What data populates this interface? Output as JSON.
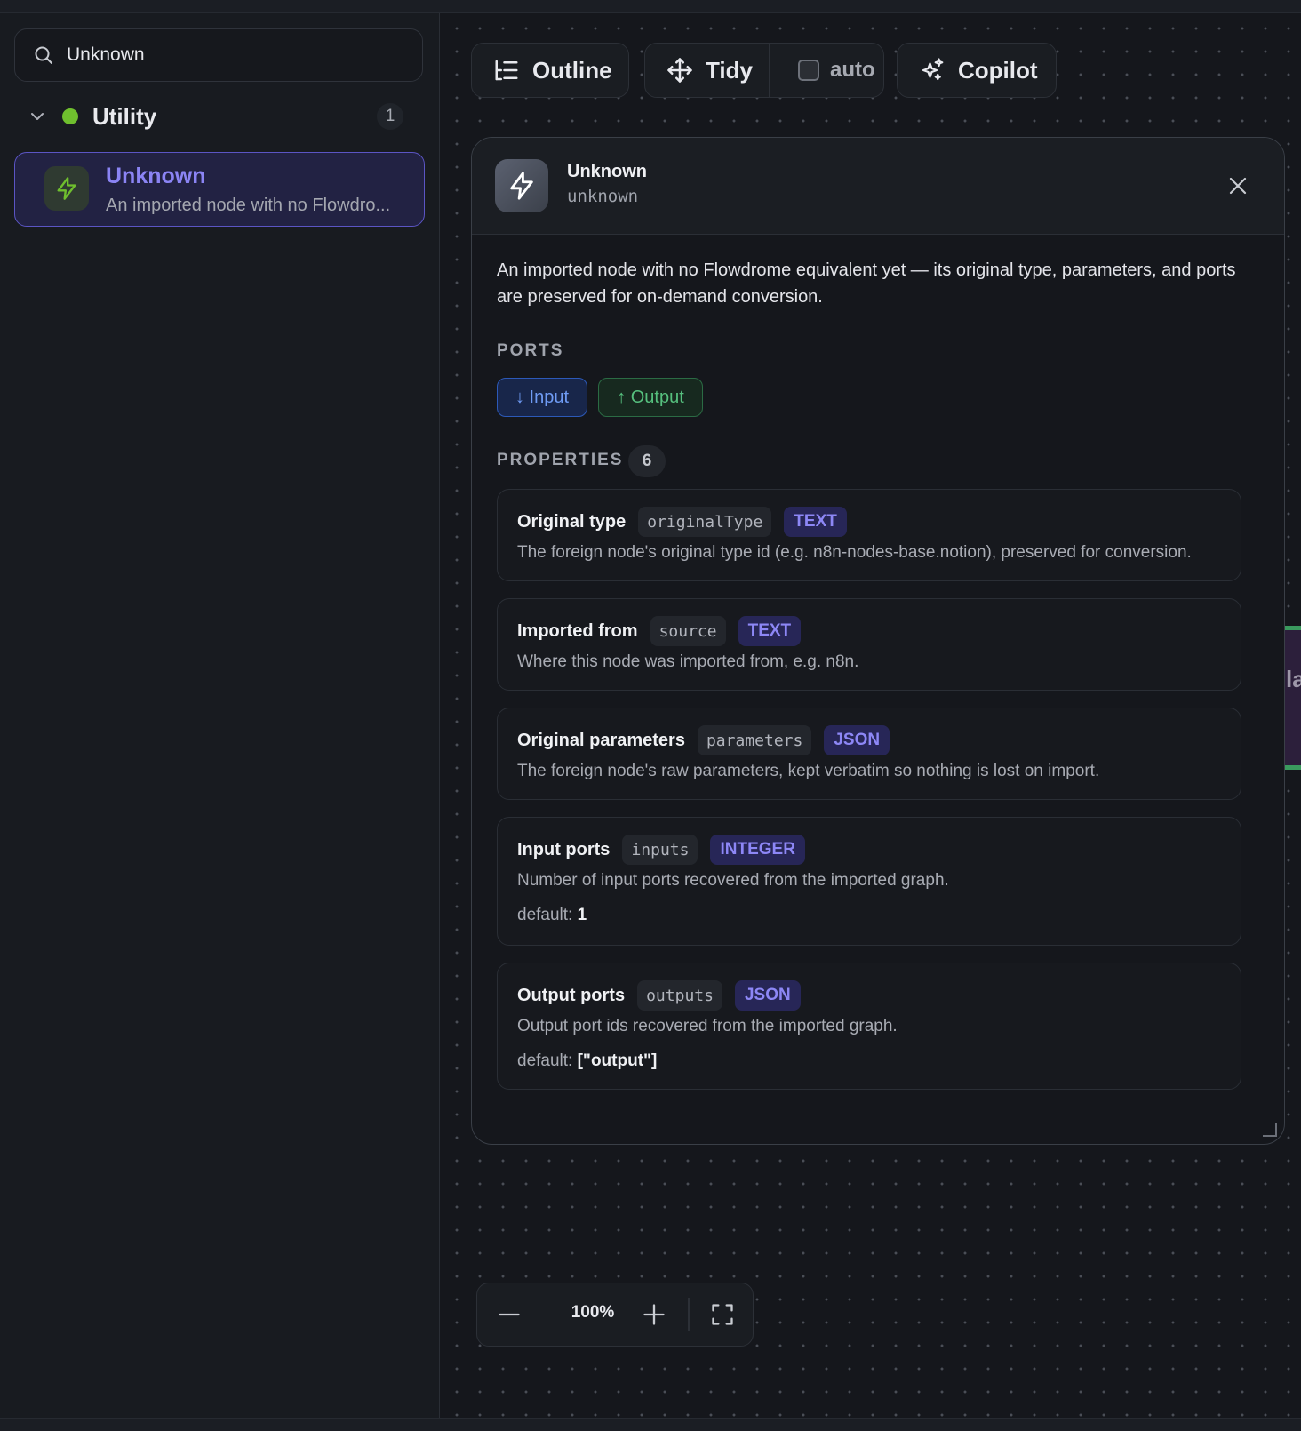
{
  "sidebar": {
    "search": {
      "value": "Unknown"
    },
    "group": {
      "label": "Utility",
      "count": "1",
      "dot_color": "#6fbf2e"
    },
    "node": {
      "title": "Unknown",
      "description": "An imported node with no Flowdro..."
    }
  },
  "toolbar": {
    "outline_label": "Outline",
    "tidy_label": "Tidy",
    "auto_label": "auto",
    "auto_checked": false,
    "copilot_label": "Copilot"
  },
  "panel": {
    "title": "Unknown",
    "subtitle": "unknown",
    "description": "An imported node with no Flowdrome equivalent yet — its original type, parameters, and ports are preserved for on-demand conversion.",
    "ports_label": "PORTS",
    "ports": {
      "input": "↓ Input",
      "output": "↑ Output"
    },
    "properties_label": "PROPERTIES",
    "properties_count": "6",
    "properties": [
      {
        "name": "Original type",
        "key": "originalType",
        "type": "TEXT",
        "description": "The foreign node's original type id (e.g. n8n-nodes-base.notion), preserved for conversion."
      },
      {
        "name": "Imported from",
        "key": "source",
        "type": "TEXT",
        "description": "Where this node was imported from, e.g. n8n."
      },
      {
        "name": "Original parameters",
        "key": "parameters",
        "type": "JSON",
        "description": "The foreign node's raw parameters, kept verbatim so nothing is lost on import."
      },
      {
        "name": "Input ports",
        "key": "inputs",
        "type": "INTEGER",
        "description": "Number of input ports recovered from the imported graph.",
        "default_label": "default:",
        "default_value": "1"
      },
      {
        "name": "Output ports",
        "key": "outputs",
        "type": "JSON",
        "description": "Output port ids recovered from the imported graph.",
        "default_label": "default:",
        "default_value": "[\"output\"]"
      }
    ]
  },
  "canvas": {
    "partial_node_text": "la"
  },
  "zoom": {
    "level": "100%"
  },
  "colors": {
    "accent": "#8b84f4",
    "input_port": "#6f9bf4",
    "output_port": "#56c07e",
    "node_icon": "#6fbf2e"
  },
  "icons": [
    "search-icon",
    "chevron-down-icon",
    "bolt-icon",
    "outline-icon",
    "move-icon",
    "sparkles-icon",
    "close-icon",
    "minus-icon",
    "plus-icon",
    "fit-view-icon"
  ]
}
